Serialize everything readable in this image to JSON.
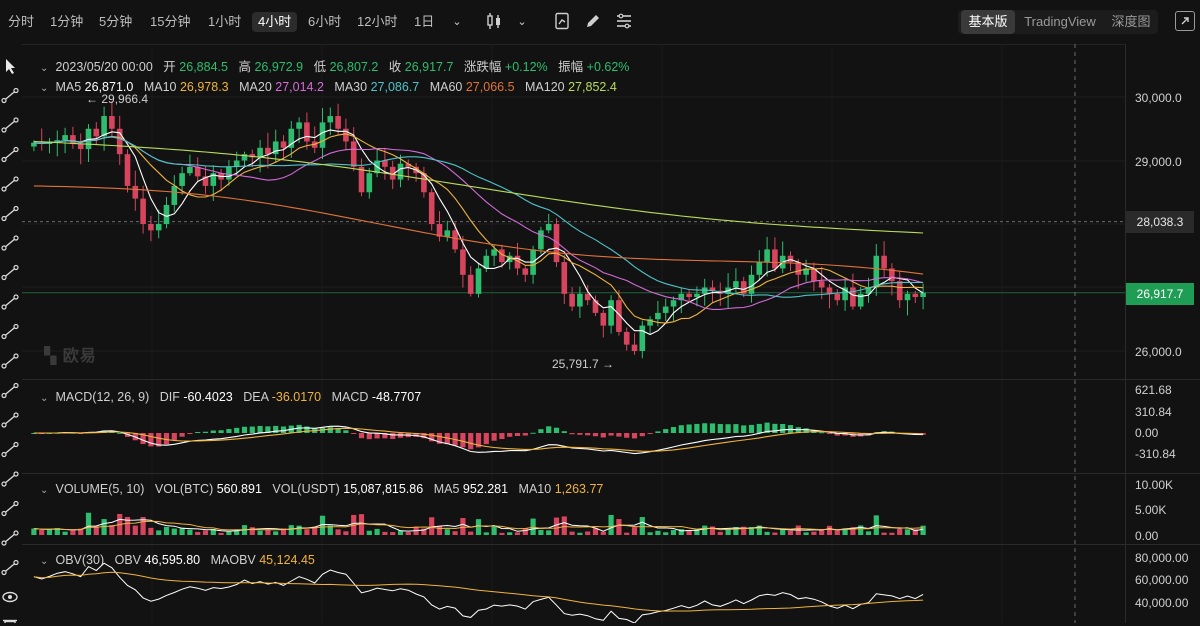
{
  "toolbar": {
    "timeframes": [
      "分时",
      "1分钟",
      "5分钟",
      "15分钟",
      "1小时",
      "4小时",
      "6小时",
      "12小时",
      "1日"
    ],
    "active_timeframe": "4小时",
    "views": [
      "基本版",
      "TradingView",
      "深度图"
    ],
    "active_view": "基本版"
  },
  "ohlc": {
    "date": "2023/05/20 00:00",
    "open_label": "开",
    "open": "26,884.5",
    "high_label": "高",
    "high": "26,972.9",
    "low_label": "低",
    "low": "26,807.2",
    "close_label": "收",
    "close": "26,917.7",
    "change_label": "涨跌幅",
    "change": "+0.12%",
    "amplitude_label": "振幅",
    "amplitude": "+0.62%"
  },
  "ma": {
    "items": [
      {
        "label": "MA5",
        "value": "26,871.0",
        "color": "#ffffff"
      },
      {
        "label": "MA10",
        "value": "26,978.3",
        "color": "#f0b43c"
      },
      {
        "label": "MA20",
        "value": "27,014.2",
        "color": "#d36bd9"
      },
      {
        "label": "MA30",
        "value": "27,086.7",
        "color": "#4fc3c9"
      },
      {
        "label": "MA60",
        "value": "27,066.5",
        "color": "#e0733a"
      },
      {
        "label": "MA120",
        "value": "27,852.4",
        "color": "#b8dc5a"
      }
    ]
  },
  "price_axis": {
    "ticks": [
      "30,000.0",
      "29,000.0",
      "26,000.0"
    ],
    "crosshair_price": "28,038.3",
    "last_price": "26,917.7"
  },
  "markers": {
    "high": "29,966.4",
    "low": "25,791.7"
  },
  "watermark": "欧易",
  "macd": {
    "label": "MACD(12, 26, 9)",
    "dif_label": "DIF",
    "dif": "-60.4023",
    "dea_label": "DEA",
    "dea": "-36.0170",
    "macd_label": "MACD",
    "macd": "-48.7707",
    "ticks": [
      "621.68",
      "310.84",
      "0.00",
      "-310.84"
    ]
  },
  "volume": {
    "label": "VOLUME(5, 10)",
    "btc_label": "VOL(BTC)",
    "btc": "560.891",
    "usdt_label": "VOL(USDT)",
    "usdt": "15,087,815.86",
    "ma5_label": "MA5",
    "ma5": "952.281",
    "ma10_label": "MA10",
    "ma10": "1,263.77",
    "ticks": [
      "10.00K",
      "5.00K",
      "0.00"
    ]
  },
  "obv": {
    "label": "OBV(30)",
    "obv_label": "OBV",
    "obv": "46,595.80",
    "maobv_label": "MAOBV",
    "maobv": "45,124.45",
    "ticks": [
      "80,000.00",
      "60,000.00",
      "40,000.00"
    ]
  },
  "colors": {
    "up": "#2ebd6e",
    "down": "#d6455d",
    "bg": "#121212",
    "grid": "#1f1f1f"
  },
  "chart_data": {
    "type": "candlestick",
    "interval": "4小时",
    "closes": [
      29280,
      29260,
      29300,
      29320,
      29400,
      29260,
      29180,
      29500,
      29380,
      29700,
      29500,
      29100,
      28600,
      28400,
      28000,
      27900,
      28000,
      28300,
      28600,
      28800,
      28900,
      28750,
      28600,
      28800,
      28700,
      28900,
      29000,
      29100,
      29050,
      29200,
      29100,
      29300,
      29200,
      29500,
      29600,
      29300,
      29200,
      29600,
      29700,
      29500,
      29300,
      28900,
      28500,
      28800,
      29000,
      28900,
      28700,
      28950,
      28900,
      28800,
      28500,
      28000,
      27800,
      27900,
      27600,
      27200,
      26900,
      27300,
      27500,
      27600,
      27400,
      27500,
      27300,
      27200,
      27600,
      27900,
      28000,
      27400,
      26900,
      26700,
      26900,
      26800,
      26600,
      26400,
      26800,
      26300,
      26100,
      26000,
      26400,
      26500,
      26600,
      26700,
      26800,
      26900,
      26850,
      26900,
      27000,
      26950,
      26900,
      27000,
      27100,
      26900,
      27200,
      27400,
      27600,
      27300,
      27500,
      27400,
      27200,
      27300,
      27100,
      27000,
      26900,
      26800,
      27000,
      26700,
      26900,
      27000,
      27500,
      27300,
      27100,
      26800,
      26900,
      26850,
      26917.7
    ],
    "ma120_end": 27852.4,
    "high_marker": 29966.4,
    "low_marker": 25791.7
  }
}
